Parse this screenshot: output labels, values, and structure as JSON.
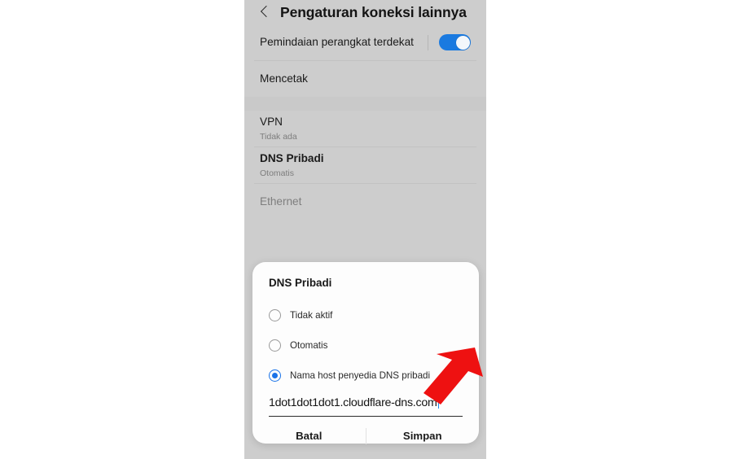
{
  "header": {
    "back_icon": "chevron-left-icon",
    "title": "Pengaturan koneksi lainnya"
  },
  "settings_list": {
    "sections": [
      {
        "rows": [
          {
            "title": "Pemindaian perangkat terdekat",
            "subtitle": "",
            "control": "toggle",
            "toggle_on": true,
            "disabled": false
          },
          {
            "title": "Mencetak",
            "subtitle": "",
            "control": "none",
            "disabled": false
          }
        ]
      },
      {
        "rows": [
          {
            "title": "VPN",
            "subtitle": "Tidak ada",
            "control": "none",
            "disabled": false
          },
          {
            "title": "DNS Pribadi",
            "subtitle": "Otomatis",
            "control": "none",
            "disabled": false
          },
          {
            "title": "Ethernet",
            "subtitle": "",
            "control": "none",
            "disabled": true
          }
        ]
      }
    ]
  },
  "dialog": {
    "title": "DNS Pribadi",
    "options": [
      {
        "label": "Tidak aktif",
        "selected": false
      },
      {
        "label": "Otomatis",
        "selected": false
      },
      {
        "label": "Nama host penyedia DNS pribadi",
        "selected": true
      }
    ],
    "hostname_input": {
      "value": "1dot1dot1dot1.cloudflare-dns.com",
      "placeholder": "Nama host penyedia DNS"
    },
    "cancel_label": "Batal",
    "save_label": "Simpan"
  },
  "annotation": {
    "arrow_icon": "red-arrow-down-left",
    "arrow_color": "#ee1111"
  },
  "colors": {
    "accent": "#1a73e8",
    "toggle_on": "#1a7ae0",
    "screen_bg": "#cdcdcd",
    "dialog_bg": "#fdfdfd",
    "text_primary": "#1a1a1a",
    "text_secondary": "#7d7d7d",
    "text_disabled": "#7e7e7e",
    "arrow": "#ee1111"
  }
}
